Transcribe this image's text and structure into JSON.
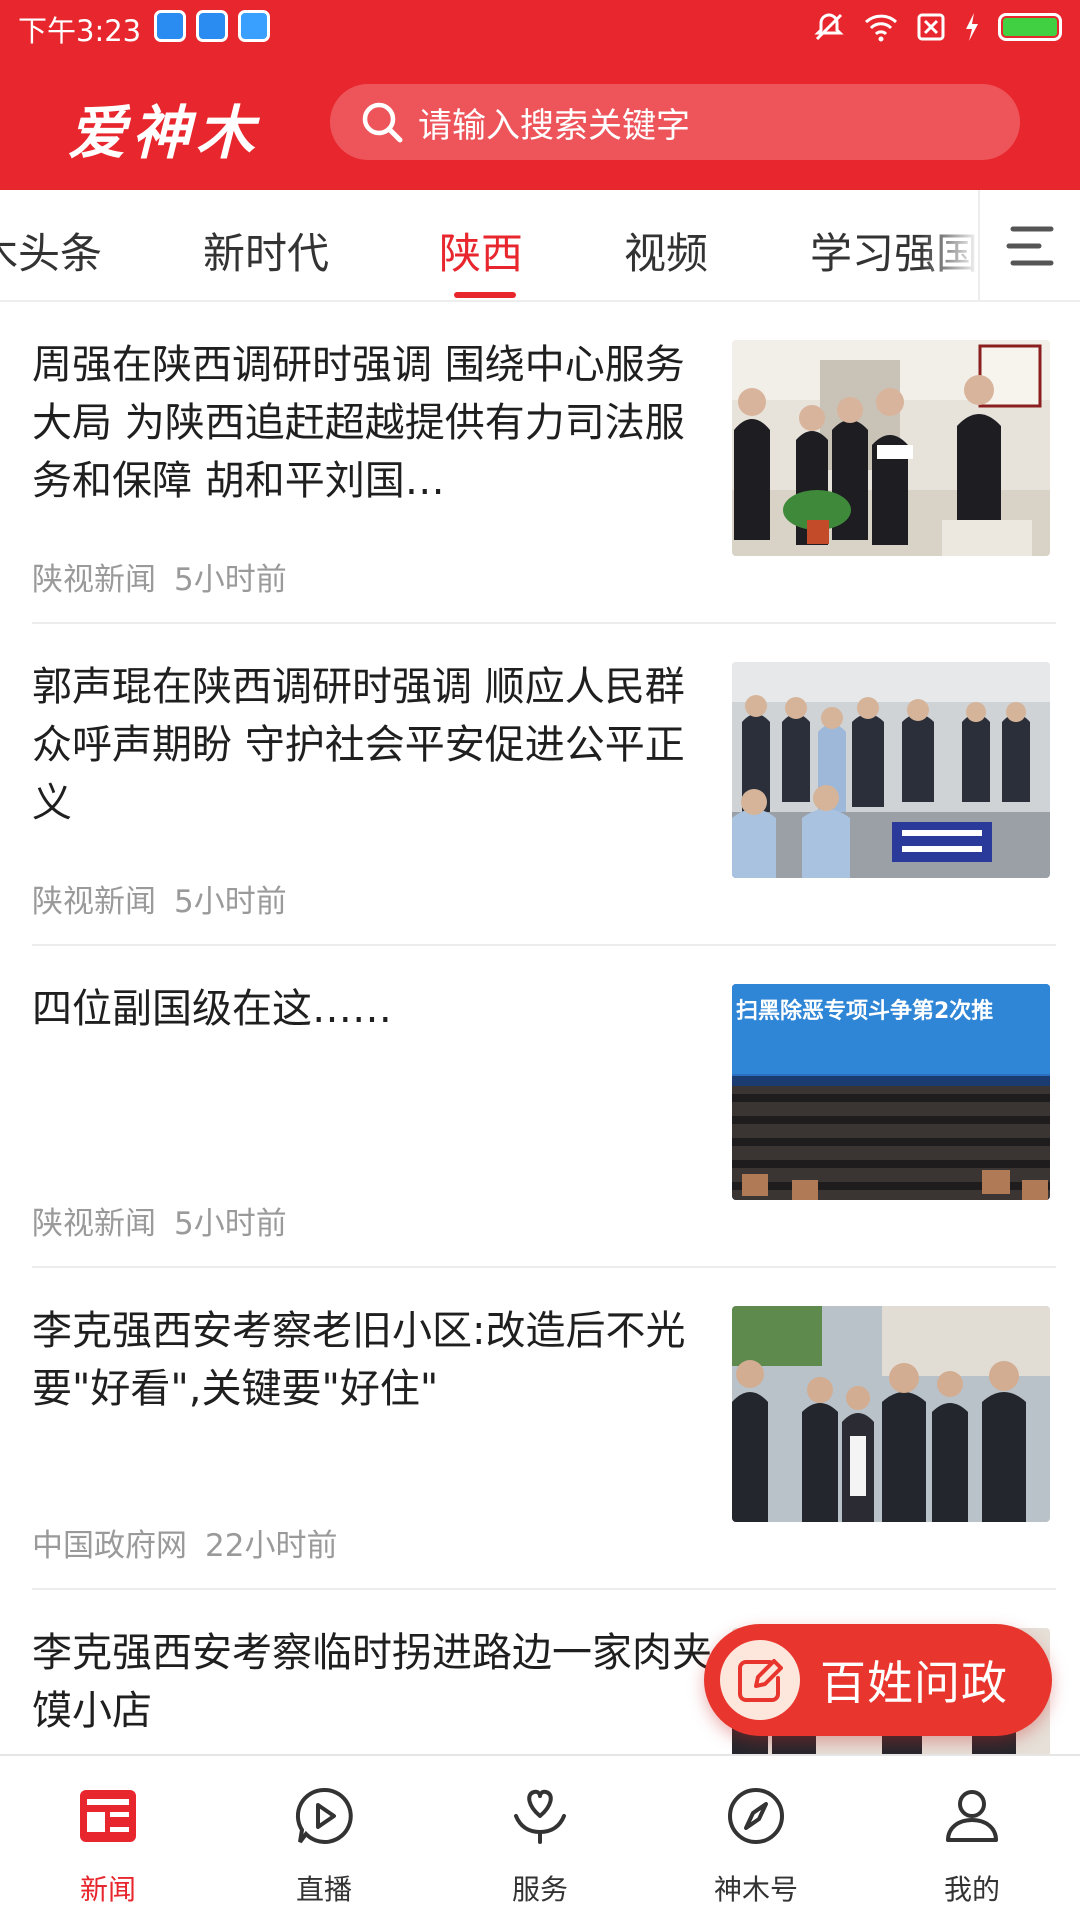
{
  "status_bar": {
    "time": "下午3:23"
  },
  "header": {
    "logo": "爱神木",
    "search_placeholder": "请输入搜索关键字"
  },
  "tabs": [
    {
      "label": "木头条"
    },
    {
      "label": "新时代"
    },
    {
      "label": "陕西",
      "active": true
    },
    {
      "label": "视频"
    },
    {
      "label": "学习强国"
    }
  ],
  "articles": [
    {
      "title": "周强在陕西调研时强调 围绕中心服务大局 为陕西追赶超越提供有力司法服务和保障 胡和平刘国…",
      "source": "陕视新闻",
      "time": "5小时前",
      "image": "officials-reading-document"
    },
    {
      "title": "郭声琨在陕西调研时强调 顺应人民群众呼声期盼 守护社会平安促进公平正义",
      "source": "陕视新闻",
      "time": "5小时前",
      "image": "police-meeting-room"
    },
    {
      "title": "四位副国级在这……",
      "source": "陕视新闻",
      "time": "5小时前",
      "image": "conference-hall-blue-banner",
      "image_banner_text": "扫黑除恶专项斗争第2次推"
    },
    {
      "title": "李克强西安考察老旧小区:改造后不光要\"好看\",关键要\"好住\"",
      "source": "中国政府网",
      "time": "22小时前",
      "image": "premier-visiting-neighborhood"
    },
    {
      "title": "李克强西安考察临时拐进路边一家肉夹馍小店",
      "source": "",
      "time": "",
      "image": "premier-in-shop"
    }
  ],
  "fab": {
    "label": "百姓问政",
    "icon": "edit-icon"
  },
  "bottom_nav": [
    {
      "label": "新闻",
      "icon": "news-icon",
      "active": true
    },
    {
      "label": "直播",
      "icon": "live-play-icon"
    },
    {
      "label": "服务",
      "icon": "service-heart-icon"
    },
    {
      "label": "神木号",
      "icon": "compass-icon"
    },
    {
      "label": "我的",
      "icon": "user-icon"
    }
  ],
  "colors": {
    "brand_red": "#e8262d",
    "text_primary": "#1f1f1f",
    "text_meta": "#9a9a9a"
  }
}
